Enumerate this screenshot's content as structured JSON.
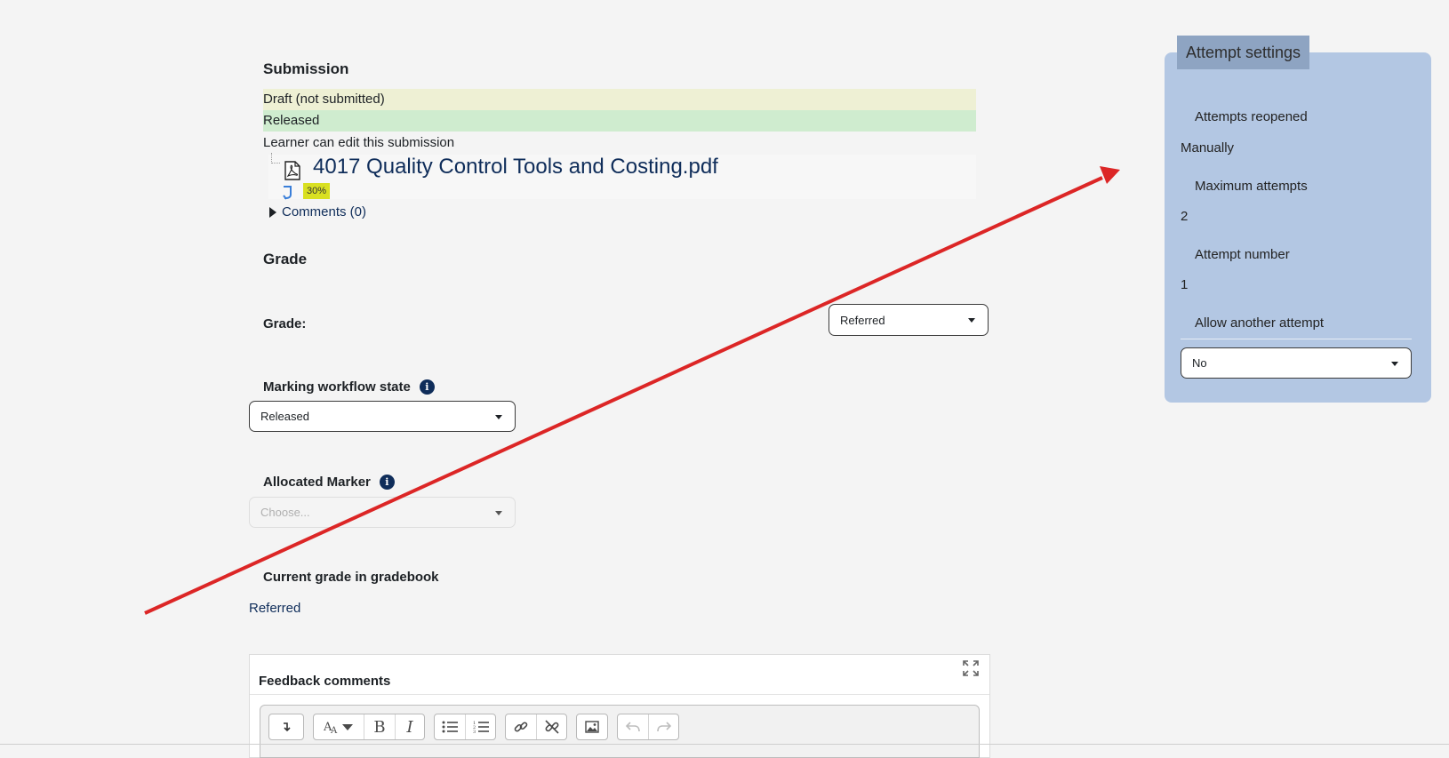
{
  "submission": {
    "heading": "Submission",
    "status_draft": "Draft (not submitted)",
    "status_released": "Released",
    "edit_note": "Learner can edit this submission",
    "file_name": "4017 Quality Control Tools and Costing.pdf",
    "similarity_percent": "30%",
    "comments_label": "Comments (0)"
  },
  "grade": {
    "heading": "Grade",
    "grade_label": "Grade:",
    "grade_value": "Referred",
    "workflow_label": "Marking workflow state",
    "workflow_value": "Released",
    "marker_label": "Allocated Marker",
    "marker_placeholder": "Choose...",
    "current_label": "Current grade in gradebook",
    "current_value": "Referred"
  },
  "feedback": {
    "title": "Feedback comments"
  },
  "editor_toolbar": {
    "groups": [
      [
        "collapse-icon"
      ],
      [
        "font-style-icon",
        "bold-icon",
        "italic-icon"
      ],
      [
        "unordered-list-icon",
        "ordered-list-icon"
      ],
      [
        "link-icon",
        "unlink-icon"
      ],
      [
        "image-icon"
      ],
      [
        "undo-icon",
        "redo-icon"
      ]
    ],
    "bold_glyph": "B",
    "italic_glyph": "I"
  },
  "attempt_settings": {
    "title": "Attempt settings",
    "reopened_label": "Attempts reopened",
    "reopened_value": "Manually",
    "max_label": "Maximum attempts",
    "max_value": "2",
    "number_label": "Attempt number",
    "number_value": "1",
    "allow_label": "Allow another attempt",
    "allow_value": "No"
  },
  "colors": {
    "draft_bg": "#eef0d4",
    "released_bg": "#cfeccf",
    "panel_bg": "#b3c7e3",
    "panel_title_bg": "#8ea4c2",
    "arrow": "#dc2626",
    "badge": "#d9e021"
  }
}
